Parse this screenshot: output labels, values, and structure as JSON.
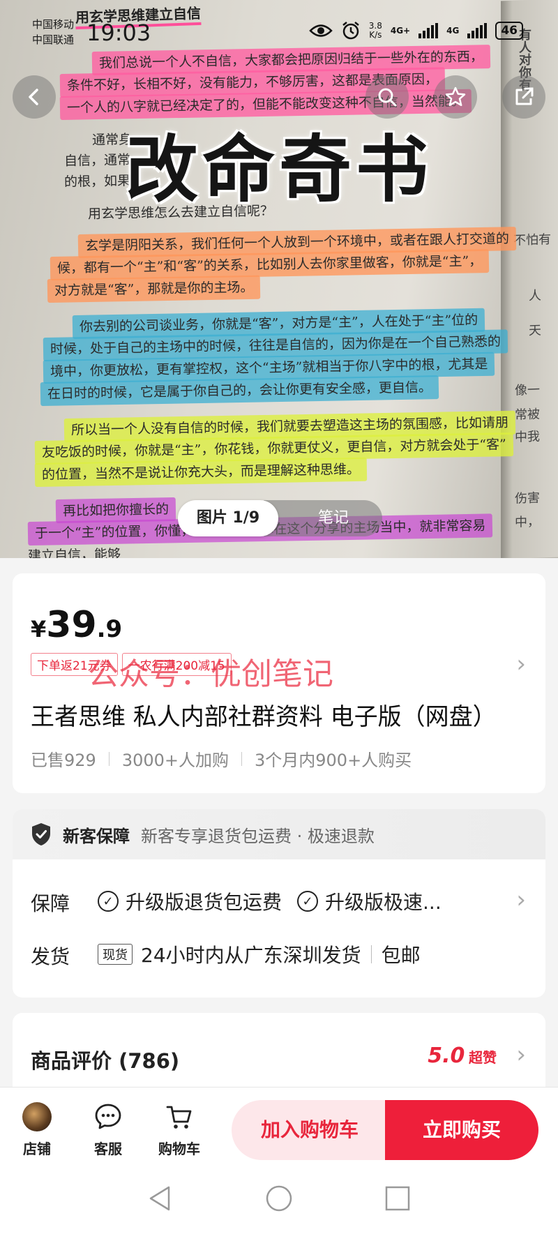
{
  "status_bar": {
    "carrier_1": "中国移动",
    "carrier_2": "中国联通",
    "time": "19:03",
    "speed_value": "3.8",
    "speed_unit": "K/s",
    "net_1": "4G+",
    "net_2": "4G",
    "battery": "46"
  },
  "hero": {
    "book_heading": "用玄学思维建立自信",
    "overlay_title": "改命奇书",
    "book_lines": [
      "我们总说一个人不自信，大家都会把原因归结于一些外在的东西，",
      "条件不好，长相不好，没有能力，不够厉害，这都是表面原因，",
      "一个人的八字就已经决定了的，但能不能改变这种不自信，当然能。",
      "通常身",
      "自信，通常",
      "的根，如果",
      "用玄学思维怎么去建立自信呢？",
      "玄学是阴阳关系，我们任何一个人放到一个环境中，或者在跟人打交道的",
      "候，都有一个“主”和“客”的关系，比如别人去你家里做客，你就是“主”，",
      "对方就是“客”，那就是你的主场。",
      "你去别的公司谈业务，你就是“客”，对方是“主”，人在处于“主”位的",
      "时候，处于自己的主场中的时候，往往是自信的，因为你是在一个自己熟悉的",
      "境中，你更放松，更有掌控权，这个“主场”就相当于你八字中的根，尤其是",
      "在日时的时候，它是属于你自己的，会让你更有安全感，更自信。",
      "所以当一个人没有自信的时候，我们就要去塑造这主场的氛围感，比如请朋",
      "友吃饭的时候，你就是“主”，你花钱，你就更仗义，更自信，对方就会处于“客”",
      "的位置，当然不是说让你充大头，而是理解这种思维。",
      "再比如把你擅长的",
      "于一个“主”的位置，你懂，他们不懂，你在这个分享的主场当中，就非常容易",
      "建立自信，能够"
    ],
    "side_text": [
      "有人对你有",
      "不怕有",
      "人",
      "天",
      "像一",
      "常被",
      "中我",
      "伤害",
      "中，"
    ],
    "counter": "图片 1/9",
    "note": "笔记"
  },
  "price_card": {
    "currency": "¥",
    "price_int": "39",
    "price_dec": ".9",
    "coupon_1": "下单返21元券",
    "coupon_2": "一农行满200减15",
    "watermark": "公众号：优创笔记",
    "title": "王者思维 私人内部社群资料 电子版（网盘）",
    "sold": "已售929",
    "carted": "3000+人加购",
    "bought": "3个月内900+人购买"
  },
  "guarantee": {
    "title": "新客保障",
    "desc": "新客专享退货包运费 · 极速退款",
    "row1_label": "保障",
    "row1_item1": "升级版退货包运费",
    "row1_item2": "升级版极速...",
    "row2_label": "发货",
    "row2_tag": "现货",
    "row2_text": "24小时内从广东深圳发货",
    "row2_extra": "包邮"
  },
  "review": {
    "title": "商品评价 (786)",
    "score": "5.0",
    "score_label": "超赞"
  },
  "bottom_bar": {
    "shop": "店铺",
    "service": "客服",
    "cart": "购物车",
    "add_cart": "加入购物车",
    "buy_now": "立即购买"
  }
}
